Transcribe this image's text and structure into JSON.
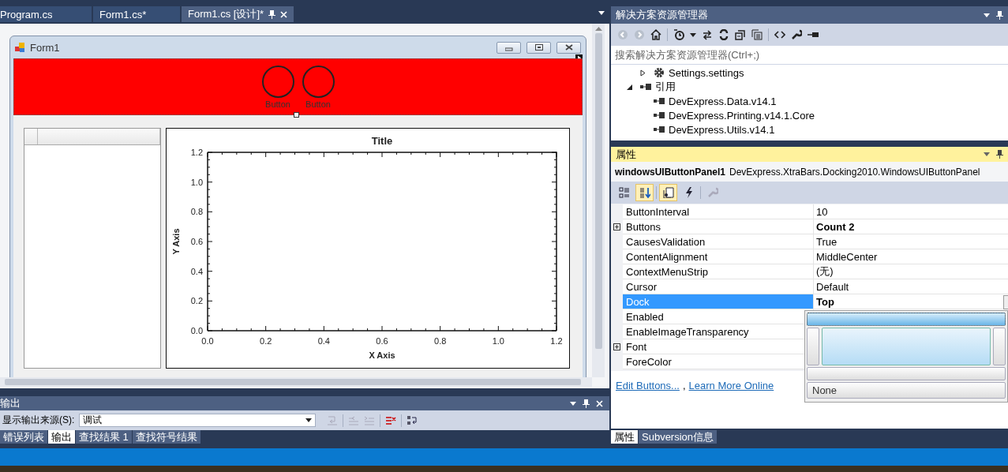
{
  "document_tabs": [
    {
      "label": "Program.cs",
      "selected": false
    },
    {
      "label": "Form1.cs*",
      "selected": false
    },
    {
      "label": "Form1.cs [设计]*",
      "selected": true
    }
  ],
  "form": {
    "title": "Form1",
    "panel_buttons": [
      {
        "label": "Button"
      },
      {
        "label": "Button"
      }
    ],
    "chart_data": {
      "type": "line",
      "title": "Title",
      "xlabel": "X Axis",
      "ylabel": "Y Axis",
      "xlim": [
        0,
        1.2
      ],
      "ylim": [
        0,
        1.2
      ],
      "xticks": [
        {
          "value": 0,
          "label": "0.0"
        },
        {
          "value": 0.2,
          "label": "0.2"
        },
        {
          "value": 0.4,
          "label": "0.4"
        },
        {
          "value": 0.6,
          "label": "0.6"
        },
        {
          "value": 0.8,
          "label": "0.8"
        },
        {
          "value": 1.0,
          "label": "1.0"
        },
        {
          "value": 1.2,
          "label": "1.2"
        }
      ],
      "yticks": [
        {
          "value": 0,
          "label": "0.0"
        },
        {
          "value": 0.2,
          "label": "0.2"
        },
        {
          "value": 0.4,
          "label": "0.4"
        },
        {
          "value": 0.6,
          "label": "0.6"
        },
        {
          "value": 0.8,
          "label": "0.8"
        },
        {
          "value": 1.0,
          "label": "1.0"
        },
        {
          "value": 1.2,
          "label": "1.2"
        }
      ]
    }
  },
  "output": {
    "title": "输出",
    "source_label": "显示输出来源(S):",
    "source_value": "调试"
  },
  "bottom_tabs": [
    {
      "label": "错误列表",
      "selected": false
    },
    {
      "label": "输出",
      "selected": true
    },
    {
      "label": "查找结果 1",
      "selected": false
    },
    {
      "label": "查找符号结果",
      "selected": false
    }
  ],
  "solution_explorer": {
    "title": "解决方案资源管理器",
    "search": {
      "placeholder": "搜索解决方案资源管理器(Ctrl+;)"
    },
    "tree": [
      {
        "children": [
          {
            "label": "Settings.settings",
            "kind": "settings",
            "expanded": false
          }
        ]
      },
      {
        "label": "引用",
        "kind": "reference",
        "expanded": true,
        "children": [
          {
            "label": "DevExpress.Data.v14.1",
            "kind": "reference"
          },
          {
            "label": "DevExpress.Printing.v14.1.Core",
            "kind": "reference"
          },
          {
            "label": "DevExpress.Utils.v14.1",
            "kind": "reference"
          }
        ]
      }
    ]
  },
  "properties": {
    "title": "属性",
    "object_name": "windowsUIButtonPanel1",
    "object_type": "DevExpress.XtraBars.Docking2010.WindowsUIButtonPanel",
    "toolbar": [
      {
        "kind": "categorized",
        "selected": false
      },
      {
        "kind": "alphabetical",
        "selected": true
      },
      {
        "kind": "pages",
        "selected": true
      },
      {
        "kind": "events",
        "selected": false
      },
      {
        "kind": "wrench",
        "selected": false
      }
    ],
    "rows": [
      {
        "name": "ButtonInterval",
        "value": "10",
        "expandable": false,
        "modified": false,
        "selected": false
      },
      {
        "name": "Buttons",
        "value": "Count 2",
        "expandable": true,
        "modified": true,
        "selected": false
      },
      {
        "name": "CausesValidation",
        "value": "True",
        "expandable": false,
        "modified": false,
        "selected": false
      },
      {
        "name": "ContentAlignment",
        "value": "MiddleCenter",
        "expandable": false,
        "modified": false,
        "selected": false
      },
      {
        "name": "ContextMenuStrip",
        "value": "(无)",
        "expandable": false,
        "modified": false,
        "selected": false
      },
      {
        "name": "Cursor",
        "value": "Default",
        "expandable": false,
        "modified": false,
        "selected": false
      },
      {
        "name": "Dock",
        "value": "Top",
        "expandable": false,
        "modified": true,
        "selected": true
      },
      {
        "name": "Enabled",
        "expandable": false,
        "selected": false
      },
      {
        "name": "EnableImageTransparency",
        "expandable": false,
        "selected": false
      },
      {
        "name": "Font",
        "expandable": true,
        "selected": false
      },
      {
        "name": "ForeColor",
        "expandable": false,
        "selected": false
      }
    ],
    "links": [
      {
        "label": "Edit Buttons..."
      },
      {
        "label": "Learn More Online"
      }
    ],
    "link_separator": ",",
    "dock_editor": {
      "options": [
        {
          "kind": "top",
          "selected": true
        },
        {
          "kind": "left",
          "selected": false
        },
        {
          "kind": "fill",
          "selected": false
        },
        {
          "kind": "right",
          "selected": false
        },
        {
          "kind": "bottom",
          "selected": false
        },
        {
          "kind": "none",
          "label": "None",
          "selected": false
        }
      ]
    }
  },
  "properties_tabs": [
    {
      "label": "属性",
      "selected": true
    },
    {
      "label": "Subversion信息",
      "selected": false
    }
  ]
}
